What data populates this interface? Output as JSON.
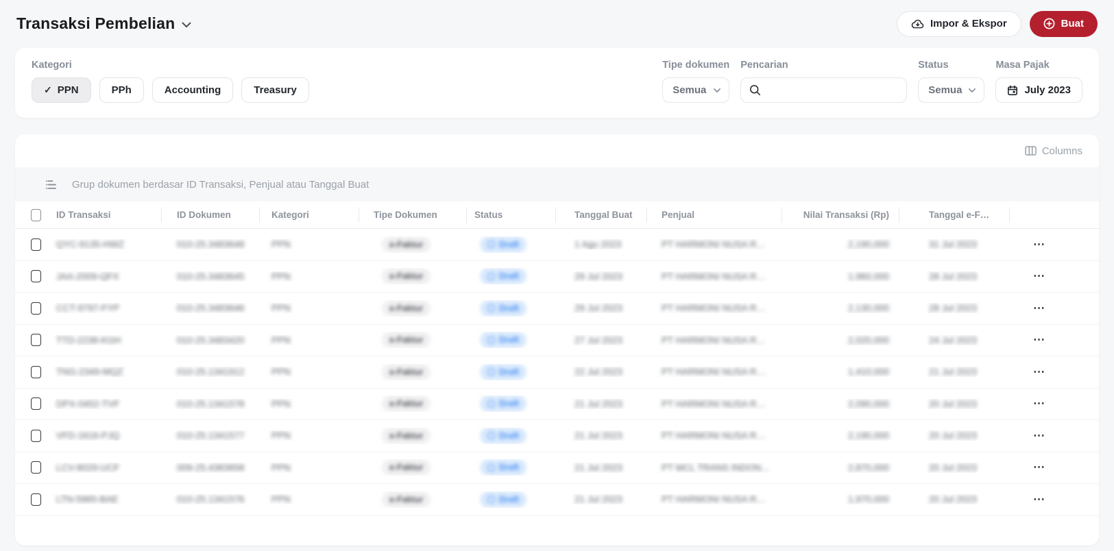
{
  "header": {
    "title": "Transaksi Pembelian",
    "import_export_label": "Impor & Ekspor",
    "create_label": "Buat"
  },
  "filters": {
    "kategori_label": "Kategori",
    "chips": [
      {
        "label": "PPN",
        "selected": true
      },
      {
        "label": "PPh",
        "selected": false
      },
      {
        "label": "Accounting",
        "selected": false
      },
      {
        "label": "Treasury",
        "selected": false
      }
    ],
    "tipe_dokumen_label": "Tipe dokumen",
    "tipe_dokumen_value": "Semua",
    "pencarian_label": "Pencarian",
    "search_placeholder": "",
    "status_label": "Status",
    "status_value": "Semua",
    "masa_pajak_label": "Masa Pajak",
    "masa_pajak_value": "July 2023"
  },
  "table": {
    "columns_button_label": "Columns",
    "group_hint": "Grup dokumen berdasar ID Transaksi, Penjual atau Tanggal Buat",
    "headers": [
      "ID Transaksi",
      "ID Dokumen",
      "Kategori",
      "Tipe Dokumen",
      "Status",
      "Tanggal Buat",
      "Penjual",
      "Nilai Transaksi (Rp)",
      "Tanggal e-F…"
    ],
    "actions_icon": "⋯",
    "rows": [
      {
        "id_transaksi": "QYC-9135-HWZ",
        "id_dokumen": "010-25.3483648",
        "kategori": "PPN",
        "tipe_dokumen": "e-Faktur",
        "status": "Draft",
        "tanggal_buat": "1 Agu 2023",
        "penjual": "PT HARMONI NUSA R…",
        "nilai": "2,190,000",
        "tanggal_ef": "31 Jul 2023"
      },
      {
        "id_transaksi": "JAA-2009-QFX",
        "id_dokumen": "010-25.3483645",
        "kategori": "PPN",
        "tipe_dokumen": "e-Faktur",
        "status": "Draft",
        "tanggal_buat": "29 Jul 2023",
        "penjual": "PT HARMONI NUSA R…",
        "nilai": "1,960,000",
        "tanggal_ef": "28 Jul 2023"
      },
      {
        "id_transaksi": "CCT-9797-FYP",
        "id_dokumen": "010-25.3483646",
        "kategori": "PPN",
        "tipe_dokumen": "e-Faktur",
        "status": "Draft",
        "tanggal_buat": "29 Jul 2023",
        "penjual": "PT HARMONI NUSA R…",
        "nilai": "2,130,000",
        "tanggal_ef": "28 Jul 2023"
      },
      {
        "id_transaksi": "TTD-2238-KGH",
        "id_dokumen": "010-25.3483420",
        "kategori": "PPN",
        "tipe_dokumen": "e-Faktur",
        "status": "Draft",
        "tanggal_buat": "27 Jul 2023",
        "penjual": "PT HARMONI NUSA R…",
        "nilai": "2,020,000",
        "tanggal_ef": "24 Jul 2023"
      },
      {
        "id_transaksi": "TNG-2349-MQZ",
        "id_dokumen": "010-25.1341912",
        "kategori": "PPN",
        "tipe_dokumen": "e-Faktur",
        "status": "Draft",
        "tanggal_buat": "22 Jul 2023",
        "penjual": "PT HARMONI NUSA R…",
        "nilai": "1,410,000",
        "tanggal_ef": "21 Jul 2023"
      },
      {
        "id_transaksi": "DPX-0452-TVF",
        "id_dokumen": "010-25.1341578",
        "kategori": "PPN",
        "tipe_dokumen": "e-Faktur",
        "status": "Draft",
        "tanggal_buat": "21 Jul 2023",
        "penjual": "PT HARMONI NUSA R…",
        "nilai": "2,090,000",
        "tanggal_ef": "20 Jul 2023"
      },
      {
        "id_transaksi": "VFD-1616-PJQ",
        "id_dokumen": "010-25.1341577",
        "kategori": "PPN",
        "tipe_dokumen": "e-Faktur",
        "status": "Draft",
        "tanggal_buat": "21 Jul 2023",
        "penjual": "PT HARMONI NUSA R…",
        "nilai": "2,190,000",
        "tanggal_ef": "20 Jul 2023"
      },
      {
        "id_transaksi": "LCV-8029-UCF",
        "id_dokumen": "009-25.4383658",
        "kategori": "PPN",
        "tipe_dokumen": "e-Faktur",
        "status": "Draft",
        "tanggal_buat": "21 Jul 2023",
        "penjual": "PT MCL TRANS INDON…",
        "nilai": "2,870,000",
        "tanggal_ef": "20 Jul 2023"
      },
      {
        "id_transaksi": "LTN-5965-BAE",
        "id_dokumen": "010-25.1341576",
        "kategori": "PPN",
        "tipe_dokumen": "e-Faktur",
        "status": "Draft",
        "tanggal_buat": "21 Jul 2023",
        "penjual": "PT HARMONI NUSA R…",
        "nilai": "1,970,000",
        "tanggal_ef": "20 Jul 2023"
      }
    ]
  },
  "colors": {
    "accent_red": "#b4202e",
    "status_blue": "#4a90f4",
    "status_blue_bg": "#d9e9fc"
  }
}
